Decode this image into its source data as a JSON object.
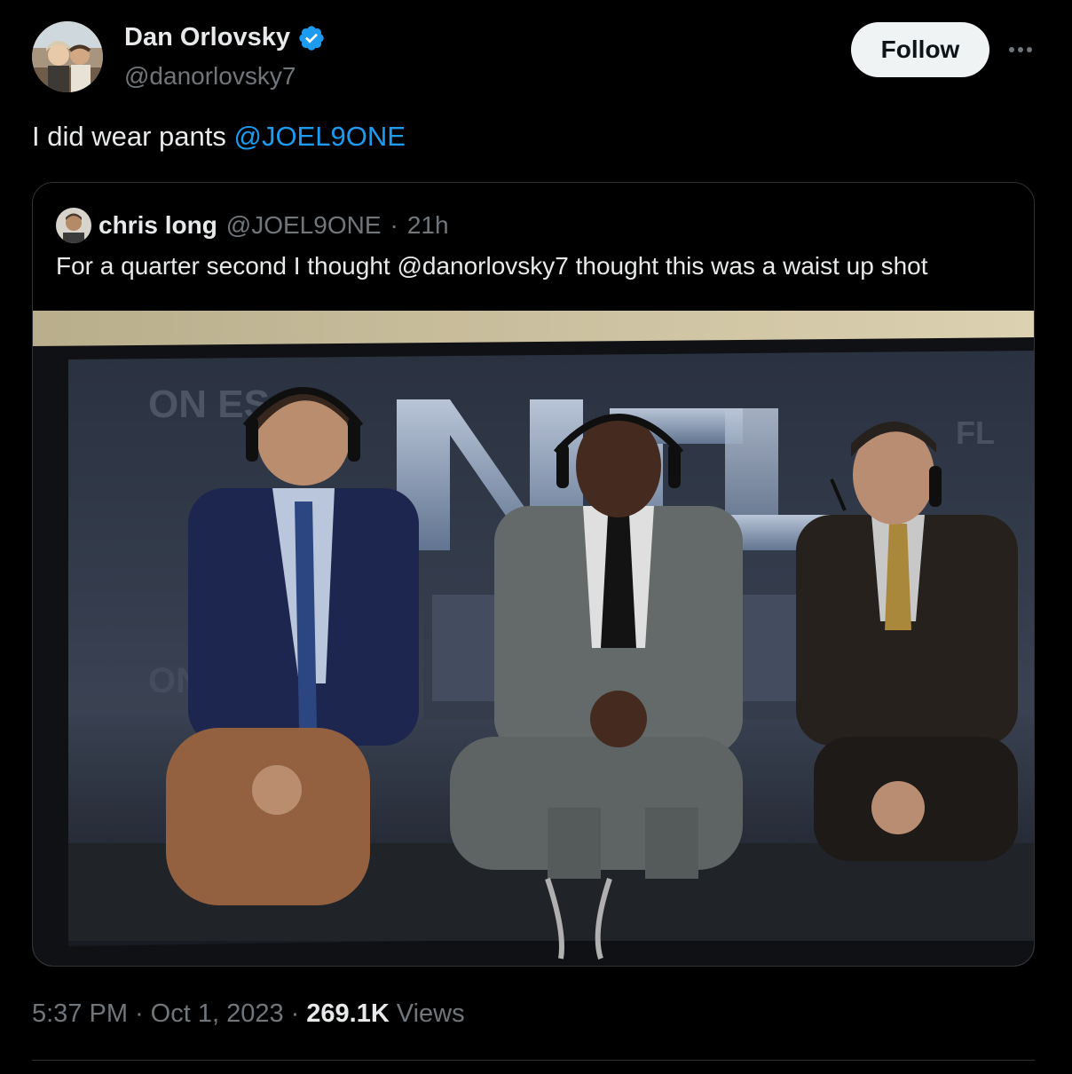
{
  "author": {
    "name": "Dan Orlovsky",
    "handle": "@danorlovsky7",
    "verified": true,
    "verified_color": "#1d9bf0"
  },
  "follow_button": {
    "label": "Follow"
  },
  "more_icon": "more-horizontal-icon",
  "tweet": {
    "text": "I did wear pants ",
    "mention": "@JOEL9ONE",
    "mention_color": "#1d9bf0"
  },
  "quoted_tweet": {
    "name": "chris long",
    "handle": "@JOEL9ONE",
    "separator": "·",
    "time": "21h",
    "text": "For a quarter second I thought @danorlovsky7 thought this was a waist up shot",
    "media_alt": "TV screen showing three NFL on ESPN commentators seated at a desk"
  },
  "meta": {
    "time": "5:37 PM",
    "sep1": "·",
    "date": "Oct 1, 2023",
    "sep2": "·",
    "views_count": "269.1K",
    "views_label": "Views"
  }
}
